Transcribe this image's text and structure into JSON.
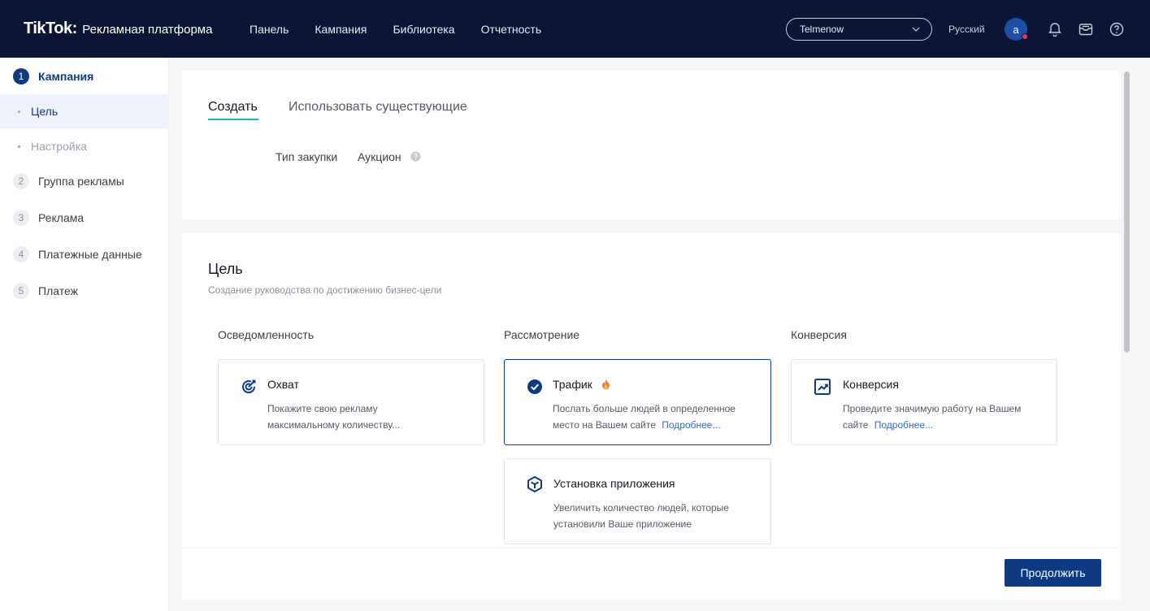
{
  "header": {
    "logo_main": "TikTok",
    "logo_colon": ":",
    "logo_sub": "Рекламная платформа",
    "nav": [
      "Панель",
      "Кампания",
      "Библиотека",
      "Отчетность"
    ],
    "account": "Telmenow",
    "language": "Русский",
    "avatar_letter": "a",
    "icons": [
      "bell-icon",
      "inbox-icon",
      "help-icon"
    ]
  },
  "sidebar": {
    "steps": [
      {
        "num": "1",
        "label": "Кампания"
      },
      {
        "num": "2",
        "label": "Группа рекламы"
      },
      {
        "num": "3",
        "label": "Реклама"
      },
      {
        "num": "4",
        "label": "Платежные данные"
      },
      {
        "num": "5",
        "label": "Платеж"
      }
    ],
    "substeps": [
      {
        "label": "Цель"
      },
      {
        "label": "Настройка"
      }
    ]
  },
  "top_card": {
    "tabs": [
      "Создать",
      "Использовать существующие"
    ],
    "buying_type_label": "Тип закупки",
    "buying_type_value": "Аукцион"
  },
  "objective": {
    "title": "Цель",
    "subtitle": "Создание руководства по достижению бизнес-цели",
    "columns": {
      "awareness": "Осведомленность",
      "consideration": "Рассмотрение",
      "conversion": "Конверсия"
    },
    "cards": {
      "reach": {
        "title": "Охват",
        "desc1": "Покажите свою рекламу",
        "desc2": "максимальному количеству..."
      },
      "traffic": {
        "title": "Трафик",
        "desc1": "Послать больше людей в определенное",
        "desc2": "место на Вашем сайте",
        "more": "Подробнее..."
      },
      "conversions": {
        "title": "Конверсия",
        "desc1": "Проведите значимую работу на Вашем",
        "desc2": "сайте",
        "more": "Подробнее..."
      },
      "app_install": {
        "title": "Установка приложения",
        "desc1": "Увеличить количество людей, которые",
        "desc2": "установили Ваше приложение"
      }
    }
  },
  "footer": {
    "continue": "Продолжить"
  },
  "colors": {
    "topbar": "#0a1634",
    "primary": "#0e3a83",
    "tab_underline": "#1bb3c6",
    "link": "#2d6ad8"
  }
}
